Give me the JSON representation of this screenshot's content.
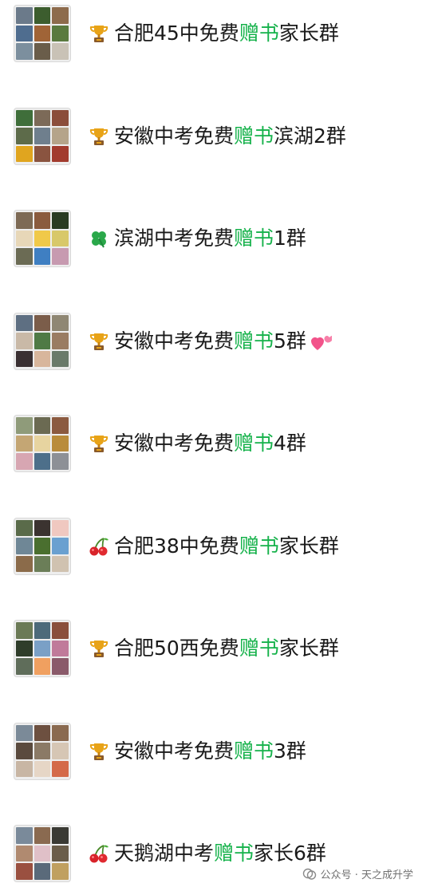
{
  "groups": [
    {
      "emoji": "trophy-icon",
      "prefix": "合肥45中免费",
      "highlight": "赠书",
      "suffix": "家长群",
      "heart": false,
      "avatar": [
        "#6b7a8a",
        "#3c5d2e",
        "#8d6b4c",
        "#4f6d8f",
        "#a06437",
        "#5a7a3f",
        "#7c8f9e",
        "#6a5d4a",
        "#c9c2b6"
      ]
    },
    {
      "emoji": "trophy-icon",
      "prefix": "安徽中考免费",
      "highlight": "赠书",
      "suffix": "滨湖2群",
      "heart": false,
      "avatar": [
        "#3f6e3a",
        "#7c6a58",
        "#8b4d3a",
        "#5d6b4a",
        "#6f7f8d",
        "#b5a48a",
        "#e0a51f",
        "#8a5440",
        "#a23b2e"
      ]
    },
    {
      "emoji": "clover-icon",
      "prefix": "滨湖中考免费",
      "highlight": "赠书",
      "suffix": "1群",
      "heart": false,
      "avatar": [
        "#7d6a55",
        "#8a5b3e",
        "#2a3b22",
        "#e7d7b8",
        "#f0c949",
        "#d8c86a",
        "#6b6b54",
        "#3f7fc2",
        "#c79ab0"
      ]
    },
    {
      "emoji": "trophy-icon",
      "prefix": "安徽中考免费",
      "highlight": "赠书",
      "suffix": "5群",
      "heart": true,
      "avatar": [
        "#5e6f82",
        "#7b5d4a",
        "#8f8773",
        "#c9b9a7",
        "#4f7a45",
        "#9a7c62",
        "#3a3032",
        "#d8b69c",
        "#6a7a6a"
      ]
    },
    {
      "emoji": "trophy-icon",
      "prefix": "安徽中考免费",
      "highlight": "赠书",
      "suffix": "4群",
      "heart": false,
      "avatar": [
        "#8f9b7a",
        "#6b6a52",
        "#8b5a40",
        "#c4a674",
        "#e7d4a0",
        "#b98c3c",
        "#d7a6b2",
        "#4d6f8a",
        "#8d9096"
      ]
    },
    {
      "emoji": "cherries-icon",
      "prefix": "合肥38中免费",
      "highlight": "赠书",
      "suffix": "家长群",
      "heart": false,
      "avatar": [
        "#5a6b4a",
        "#3b3330",
        "#f0c8c0",
        "#6f8796",
        "#4a6f2f",
        "#6aa0d0",
        "#8b6b4a",
        "#6b7e58",
        "#d0c2b0"
      ]
    },
    {
      "emoji": "trophy-icon",
      "prefix": "合肥50西免费",
      "highlight": "赠书",
      "suffix": "家长群",
      "heart": false,
      "avatar": [
        "#6b7a56",
        "#4d6a7a",
        "#8a4f3b",
        "#2f3d2a",
        "#7aa0c6",
        "#c07a9a",
        "#5f6d5a",
        "#f0a060",
        "#8a5a6a"
      ]
    },
    {
      "emoji": "trophy-icon",
      "prefix": "安徽中考免费",
      "highlight": "赠书",
      "suffix": "3群",
      "heart": false,
      "avatar": [
        "#7b8a98",
        "#6d5040",
        "#8a6a50",
        "#5a4a3e",
        "#8b7a66",
        "#d6c6b4",
        "#c8b6a4",
        "#e6d6c6",
        "#d46a4a"
      ]
    },
    {
      "emoji": "cherries-icon",
      "prefix": "天鹅湖中考",
      "highlight": "赠书",
      "suffix": "家长6群",
      "heart": false,
      "avatar": [
        "#7a8a9a",
        "#8a6a50",
        "#3a3a34",
        "#b08a70",
        "#e0c0c8",
        "#6a5d4a",
        "#9a5040",
        "#5a6a7a",
        "#c0a060"
      ]
    }
  ],
  "watermark": {
    "icon": "wechat-official-account-icon",
    "text": "公众号 · 天之成升学"
  }
}
